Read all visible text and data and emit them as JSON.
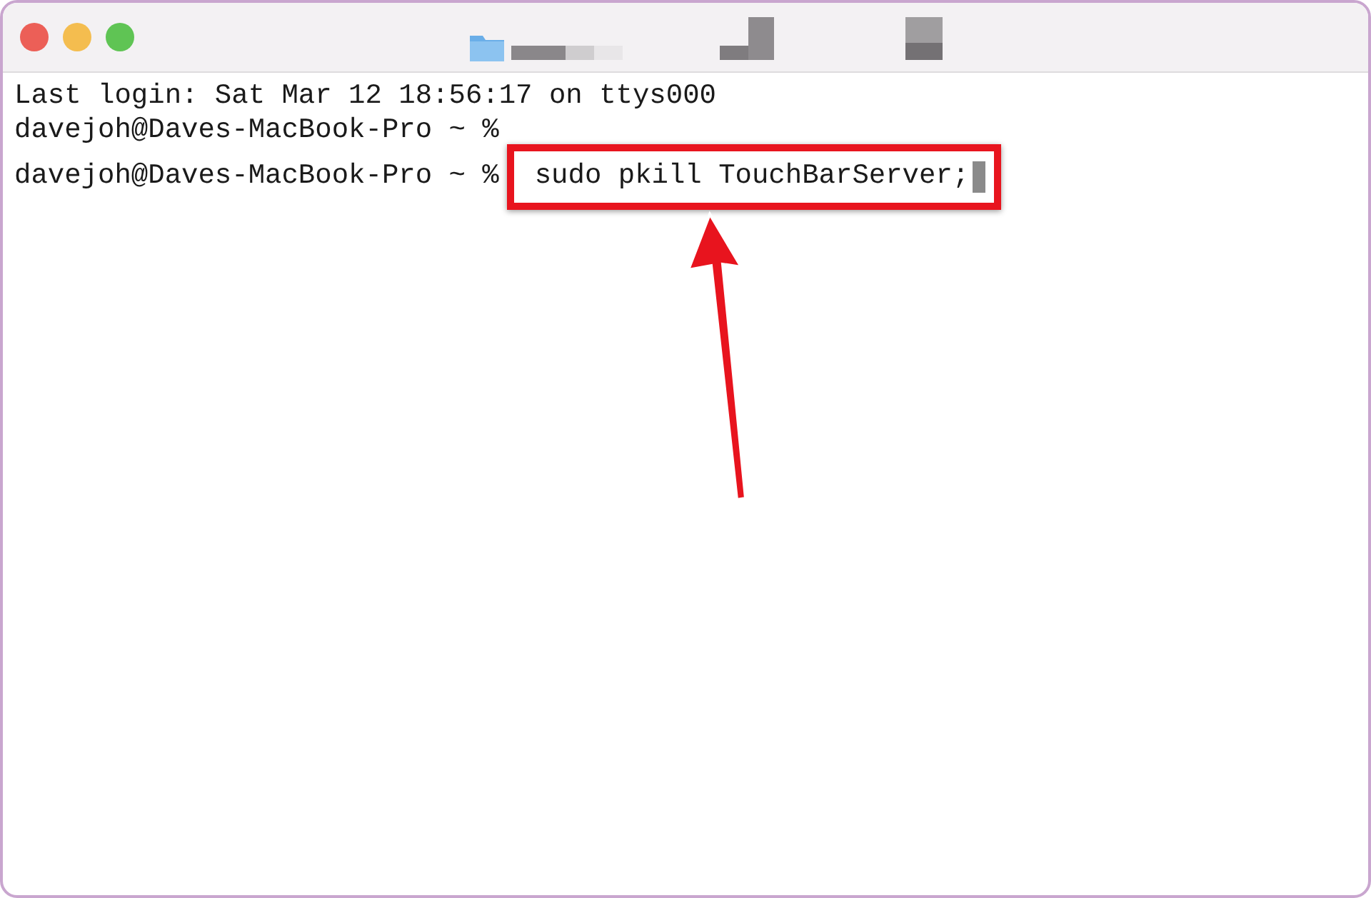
{
  "lines": [
    {
      "kind": "output",
      "text": "Last login: Sat Mar 12 18:56:17 on ttys000"
    },
    {
      "kind": "prompt",
      "text": "davejoh@Daves-MacBook-Pro ~ %"
    },
    {
      "kind": "command",
      "prompt": "davejoh@Daves-MacBook-Pro ~ %",
      "command": "sudo pkill TouchBarServer;",
      "highlighted": true,
      "cursor": true
    }
  ],
  "annotation": {
    "kind": "arrow",
    "color": "#e8141e"
  }
}
